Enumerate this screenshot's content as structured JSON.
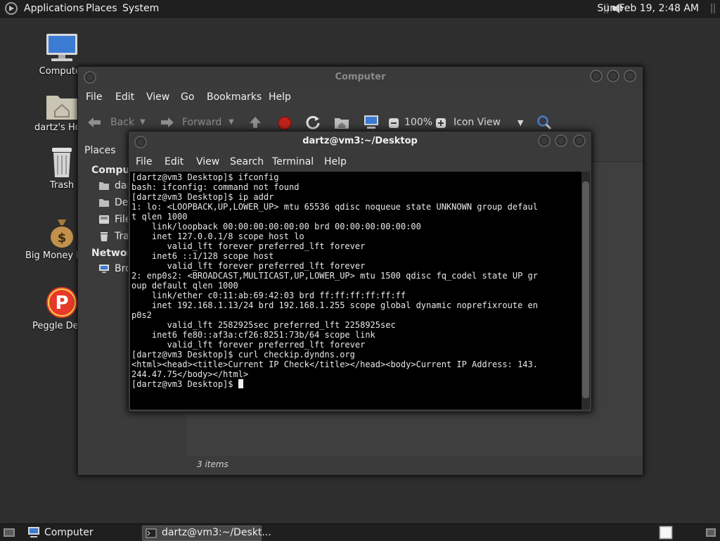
{
  "top_panel": {
    "menus": [
      "Applications",
      "Places",
      "System"
    ],
    "clock": "Sun Feb 19,  2:48 AM",
    "volume_icon": "speaker-icon"
  },
  "desktop_icons": [
    {
      "label": "Computer",
      "icon": "computer-icon"
    },
    {
      "label": "dartz's Home",
      "icon": "home-folder-icon"
    },
    {
      "label": "Trash",
      "icon": "trash-icon"
    },
    {
      "label": "Big Money Deluxe",
      "icon": "money-bag-icon"
    },
    {
      "label": "Peggle Deluxe",
      "icon": "peggle-icon"
    }
  ],
  "file_manager": {
    "title": "Computer",
    "menu": [
      "File",
      "Edit",
      "View",
      "Go",
      "Bookmarks",
      "Help"
    ],
    "toolbar": {
      "back": "Back",
      "forward": "Forward",
      "zoom": "100%",
      "view_mode": "Icon View"
    },
    "side_pane_title": "Places",
    "sidebar": {
      "computer_head": "Computer",
      "items": [
        "dartz",
        "Desktop",
        "File System",
        "Trash"
      ],
      "network_head": "Network",
      "network_items": [
        "Browse Network"
      ]
    },
    "status": "3 items"
  },
  "terminal": {
    "title": "dartz@vm3:~/Desktop",
    "menu": [
      "File",
      "Edit",
      "View",
      "Search",
      "Terminal",
      "Help"
    ],
    "lines": [
      "[dartz@vm3 Desktop]$ ifconfig",
      "bash: ifconfig: command not found",
      "[dartz@vm3 Desktop]$ ip addr",
      "1: lo: <LOOPBACK,UP,LOWER_UP> mtu 65536 qdisc noqueue state UNKNOWN group defaul",
      "t qlen 1000",
      "    link/loopback 00:00:00:00:00:00 brd 00:00:00:00:00:00",
      "    inet 127.0.0.1/8 scope host lo",
      "       valid_lft forever preferred_lft forever",
      "    inet6 ::1/128 scope host",
      "       valid_lft forever preferred_lft forever",
      "2: enp0s2: <BROADCAST,MULTICAST,UP,LOWER_UP> mtu 1500 qdisc fq_codel state UP gr",
      "oup default qlen 1000",
      "    link/ether c0:11:ab:69:42:03 brd ff:ff:ff:ff:ff:ff",
      "    inet 192.168.1.13/24 brd 192.168.1.255 scope global dynamic noprefixroute en",
      "p0s2",
      "       valid_lft 2582925sec preferred_lft 2258925sec",
      "    inet6 fe80::af3a:cf26:8251:73b/64 scope link",
      "       valid_lft forever preferred_lft forever",
      "[dartz@vm3 Desktop]$ curl checkip.dyndns.org",
      "<html><head><title>Current IP Check</title></head><body>Current IP Address: 143.",
      "244.47.75</body></html>"
    ],
    "prompt": "[dartz@vm3 Desktop]$ "
  },
  "bottom_panel": {
    "tasks": [
      "Computer",
      "dartz@vm3:~/Deskt..."
    ]
  },
  "colors": {
    "panel": "#1f1f1f",
    "desktop": "#2e2e2e",
    "terminal_bg": "#000000",
    "close_red": "#c0221c"
  }
}
